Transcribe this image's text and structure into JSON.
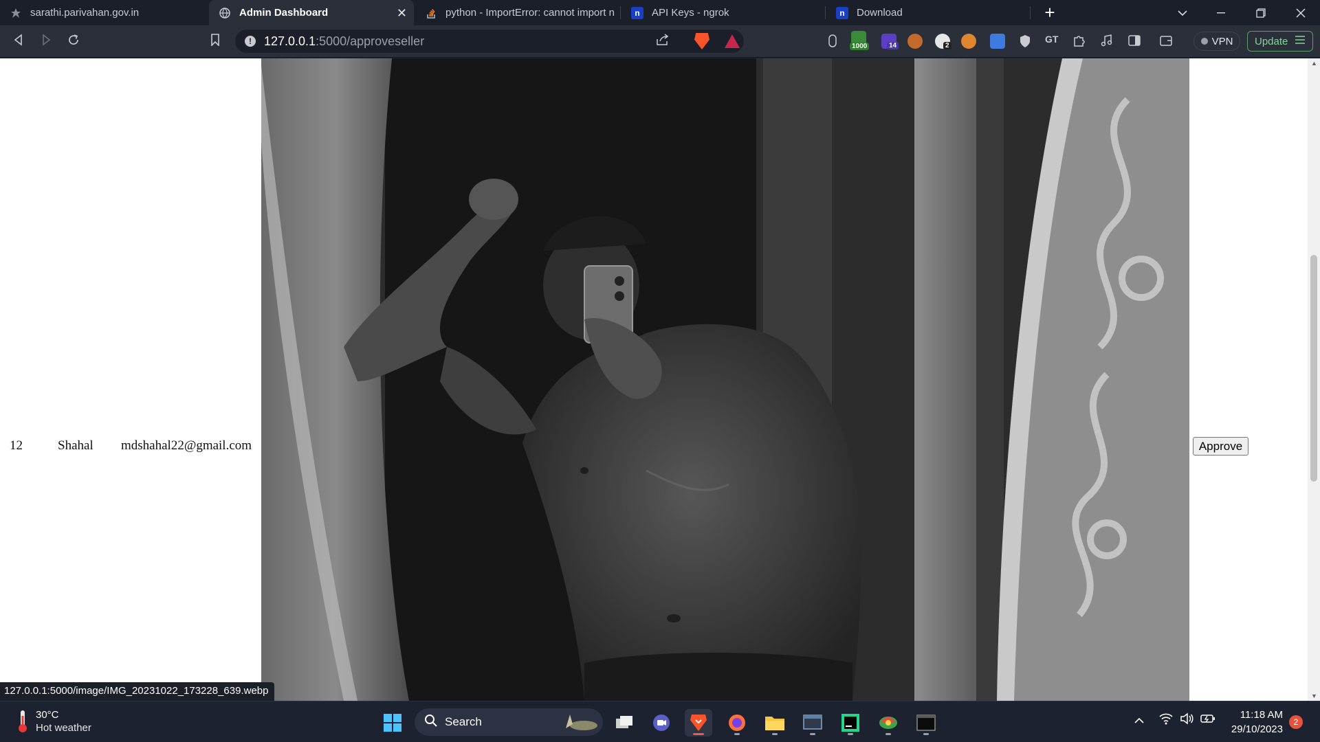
{
  "browser": {
    "tabs": [
      {
        "title": "sarathi.parivahan.gov.in",
        "active": false,
        "icon": "gov-emblem-icon"
      },
      {
        "title": "Admin Dashboard",
        "active": true,
        "icon": "globe-icon"
      },
      {
        "title": "python - ImportError: cannot import n",
        "active": false,
        "icon": "stackoverflow-icon"
      },
      {
        "title": "API Keys - ngrok",
        "active": false,
        "icon": "ngrok-icon"
      },
      {
        "title": "Download",
        "active": false,
        "icon": "ngrok-icon"
      }
    ],
    "new_tab_label": "+",
    "url_host": "127.0.0.1",
    "url_rest": ":5000/approveseller",
    "extension_badges": {
      "counter": "1000",
      "badge2": "14",
      "badge3": "2"
    },
    "vpn_label": "VPN",
    "update_label": "Update"
  },
  "page": {
    "row": {
      "id": "12",
      "name": "Shahal",
      "email": "mdshahal22@gmail.com",
      "approve_label": "Approve"
    },
    "status_url": "127.0.0.1:5000/image/IMG_20231022_173228_639.webp"
  },
  "taskbar": {
    "weather_temp": "30°C",
    "weather_desc": "Hot weather",
    "search_label": "Search",
    "time": "11:18 AM",
    "date": "29/10/2023",
    "notification_count": "2"
  },
  "colors": {
    "accent": "#fb542b",
    "tab_active": "#2b2f3a",
    "update_green": "#87d39a"
  }
}
